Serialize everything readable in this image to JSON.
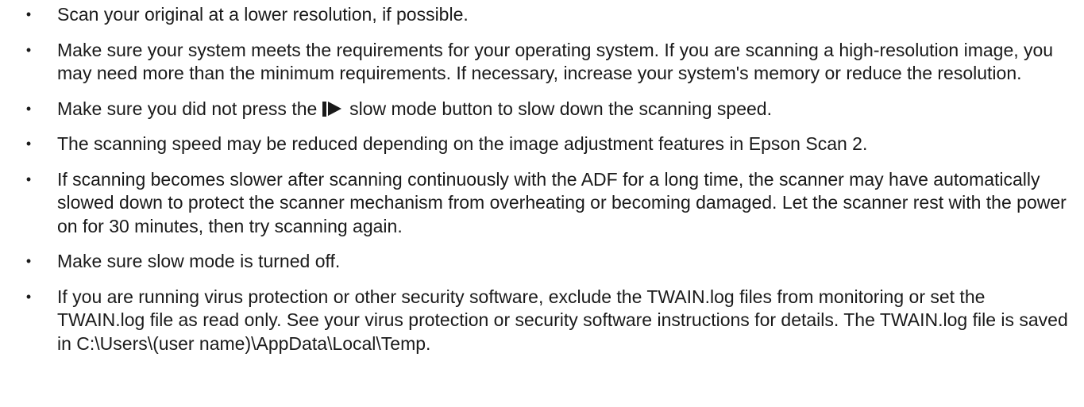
{
  "bullet_glyph": "•",
  "items": [
    {
      "text": "Scan your original at a lower resolution, if possible."
    },
    {
      "text": "Make sure your system meets the requirements for your operating system. If you are scanning a high-resolution image, you may need more than the minimum requirements. If necessary, increase your system's memory or reduce the resolution."
    },
    {
      "text_before": "Make sure you did not press the",
      "icon": "slow-mode-button-icon",
      "text_after": "slow mode button to slow down the scanning speed."
    },
    {
      "text": "The scanning speed may be reduced depending on the image adjustment features in Epson Scan 2."
    },
    {
      "text": "If scanning becomes slower after scanning continuously with the ADF for a long time, the scanner may have automatically slowed down to protect the scanner mechanism from overheating or becoming damaged. Let the scanner rest with the power on for 30 minutes, then try scanning again."
    },
    {
      "text": "Make sure slow mode is turned off."
    },
    {
      "text": "If you are running virus protection or other security software, exclude the TWAIN.log files from monitoring or set the TWAIN.log file as read only. See your virus protection or security software instructions for details. The TWAIN.log file is saved in C:\\Users\\(user name)\\AppData\\Local\\Temp."
    }
  ]
}
